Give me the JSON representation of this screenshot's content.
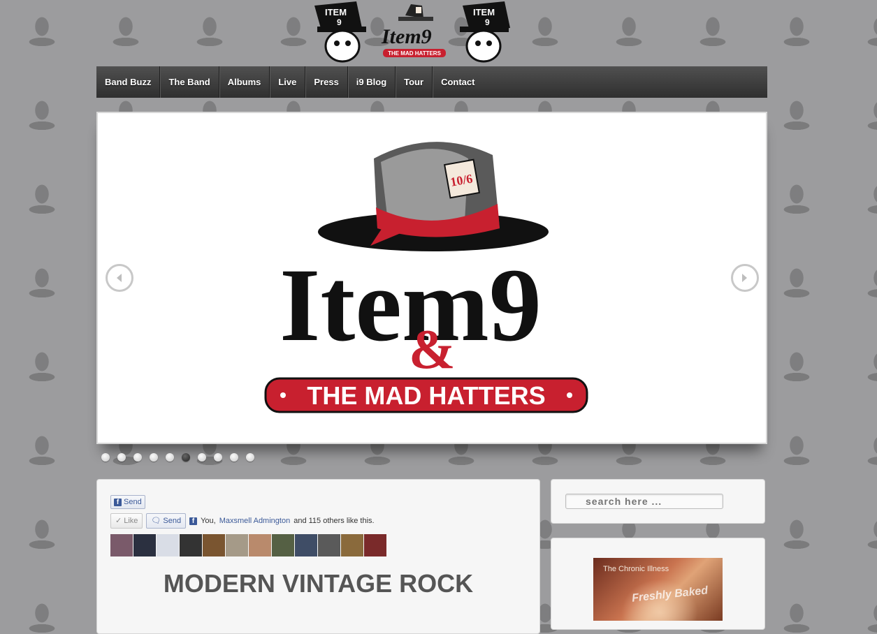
{
  "nav": {
    "items": [
      {
        "label": "Band Buzz"
      },
      {
        "label": "The Band"
      },
      {
        "label": "Albums"
      },
      {
        "label": "Live"
      },
      {
        "label": "Press"
      },
      {
        "label": "i9 Blog"
      },
      {
        "label": "Tour"
      },
      {
        "label": "Contact"
      }
    ]
  },
  "header": {
    "logo_text": "Item9",
    "logo_sub": "THE MAD HATTERS"
  },
  "slider": {
    "logo_title": "Item9",
    "logo_amp": "&",
    "logo_banner": "THE MAD HATTERS",
    "hat_tag": "10/6",
    "slide_count": 10,
    "active_index": 5
  },
  "facebook": {
    "send_label": "Send",
    "like_label": "Like",
    "send_label_2": "Send",
    "social_prefix": "You,",
    "social_friend": "Maxsmell Admington",
    "social_suffix": "and 115 others like this."
  },
  "main": {
    "tagline": "MODERN VINTAGE ROCK"
  },
  "search": {
    "placeholder": "search here ..."
  },
  "ad": {
    "album_label": "The Chronic Illness",
    "album_stamp": "Freshly Baked"
  },
  "colors": {
    "accent": "#c8202f",
    "nav_bg": "#3b3b3b",
    "page_bg": "#9c9c9e"
  }
}
